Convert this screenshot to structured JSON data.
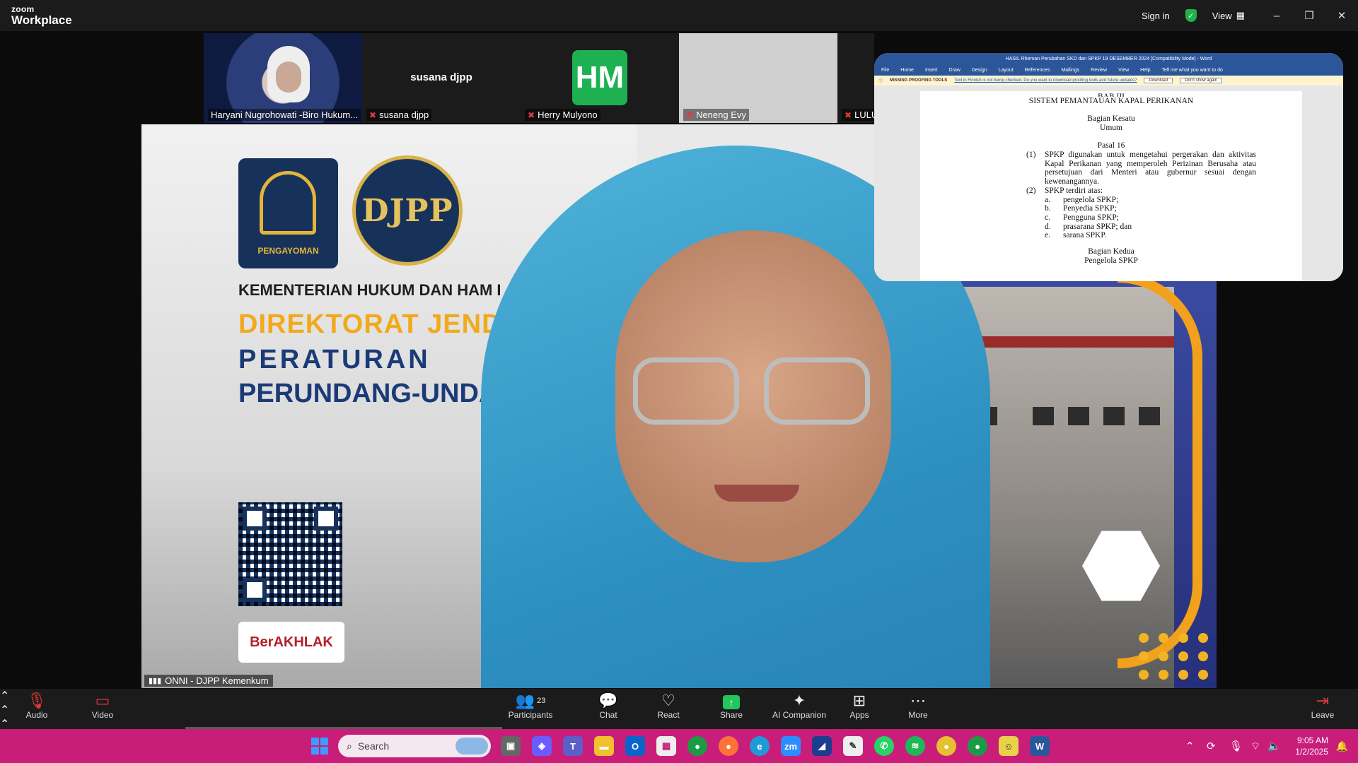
{
  "app": {
    "brand_top": "zoom",
    "brand_bottom": "Workplace"
  },
  "titlebar": {
    "sign_in": "Sign in",
    "view": "View"
  },
  "participants_strip": [
    {
      "name": "Haryani Nugrohowati -Biro Hukum..."
    },
    {
      "name": "susana djpp",
      "center_label": "susana djpp"
    },
    {
      "name": "Herry Mulyono",
      "initials": "HM",
      "avatar_color": "#1db152"
    },
    {
      "name": "Neneng Evy"
    },
    {
      "name": "LULU"
    }
  ],
  "main_video": {
    "participant_name": "ONNI - DJPP Kemenkum",
    "slide": {
      "logo1_text": "PENGAYOMAN",
      "logo2_text": "DJPP",
      "ministry": "KEMENTERIAN HUKUM DAN HAM I",
      "directorate": "DIREKTORAT JENDE",
      "reg_line1": "PERATURAN",
      "reg_line2": "PERUNDANG-UNDANG",
      "badge": "BerAKHLAK"
    }
  },
  "word_doc": {
    "title": "HASIL Rheman Perubahan SKD dan SPKP 19 DESEMBER 2024 [Compatibility Mode] - Word",
    "menu": [
      "File",
      "Home",
      "Insert",
      "Draw",
      "Design",
      "Layout",
      "References",
      "Mailings",
      "Review",
      "View",
      "Help",
      "Tell me what you want to do"
    ],
    "notice_label": "MISSING PROOFING TOOLS",
    "notice_text": "Text in Finnish is not being checked. Do you want to download proofing tools and future updates?",
    "notice_btn1": "Download",
    "notice_btn2": "Don't show again",
    "bab": "BAB III",
    "heading": "SISTEM PEMANTAUAN KAPAL PERIKANAN",
    "section1_a": "Bagian Kesatu",
    "section1_b": "Umum",
    "pasal": "Pasal 16",
    "items": [
      {
        "num": "(1)",
        "text": "SPKP digunakan untuk mengetahui pergerakan dan aktivitas Kapal Perikanan yang memperoleh Perizinan Berusaha atau persetujuan dari Menteri atau gubernur sesuai dengan kewenangannya."
      },
      {
        "num": "(2)",
        "text": "SPKP terdiri atas:"
      },
      {
        "num": "a.",
        "text": "pengelola SPKP;"
      },
      {
        "num": "b.",
        "text": "Penyedia SPKP;"
      },
      {
        "num": "c.",
        "text": "Pengguna SPKP;"
      },
      {
        "num": "d.",
        "text": "prasarana SPKP; dan"
      },
      {
        "num": "e.",
        "text": "sarana SPKP."
      }
    ],
    "section2_a": "Bagian Kedua",
    "section2_b": "Pengelola SPKP"
  },
  "controls": {
    "audio": "Audio",
    "video": "Video",
    "participants": "Participants",
    "participants_count": "23",
    "chat": "Chat",
    "react": "React",
    "share": "Share",
    "ai_companion": "AI Companion",
    "apps": "Apps",
    "more": "More",
    "leave": "Leave"
  },
  "taskbar": {
    "search_placeholder": "Search",
    "time": "9:05 AM",
    "date": "1/2/2025"
  }
}
